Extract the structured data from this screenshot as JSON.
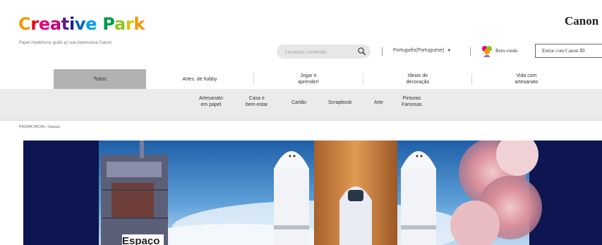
{
  "header": {
    "logo_letters": [
      {
        "char": "C",
        "color": "#f39800"
      },
      {
        "char": "r",
        "color": "#e60012"
      },
      {
        "char": "e",
        "color": "#e4007f"
      },
      {
        "char": "a",
        "color": "#c2007f"
      },
      {
        "char": "t",
        "color": "#601986"
      },
      {
        "char": "i",
        "color": "#1d2088"
      },
      {
        "char": "v",
        "color": "#0068b7"
      },
      {
        "char": "e",
        "color": "#00a0e9"
      },
      {
        "char": " ",
        "color": "#000000"
      },
      {
        "char": "P",
        "color": "#009944"
      },
      {
        "char": "a",
        "color": "#8fc31f"
      },
      {
        "char": "r",
        "color": "#d8c300"
      },
      {
        "char": "k",
        "color": "#f39800"
      }
    ],
    "tagline": "Papel modelismo grátis p/ sua impressora Canon",
    "brand": "Canon",
    "search_placeholder": "Localizar conteúdo",
    "language": "Português(Portuguese)",
    "welcome": "Bem-vindo",
    "login_button": "Entrar com Canon ID"
  },
  "nav": {
    "tabs": [
      {
        "label": "Todos",
        "active": true
      },
      {
        "label": "Artes. de hobby",
        "active": false
      },
      {
        "label": "Jogar e\naprender!",
        "active": false
      },
      {
        "label": "Ideias de\ndecoração",
        "active": false
      },
      {
        "label": "Vida com\nartesanato",
        "active": false
      }
    ],
    "subitems": [
      {
        "label": "Artesanato\nem papel"
      },
      {
        "label": "Casa e\nbem-estar"
      },
      {
        "label": "Cartão"
      },
      {
        "label": "Scrapbook"
      },
      {
        "label": "Arte"
      },
      {
        "label": "Pinturas\nFamosas"
      }
    ]
  },
  "breadcrumb": "PÁGINA INICIAL / Espaço",
  "hero": {
    "title": "Espaço",
    "accent_color": "#0d1650"
  }
}
